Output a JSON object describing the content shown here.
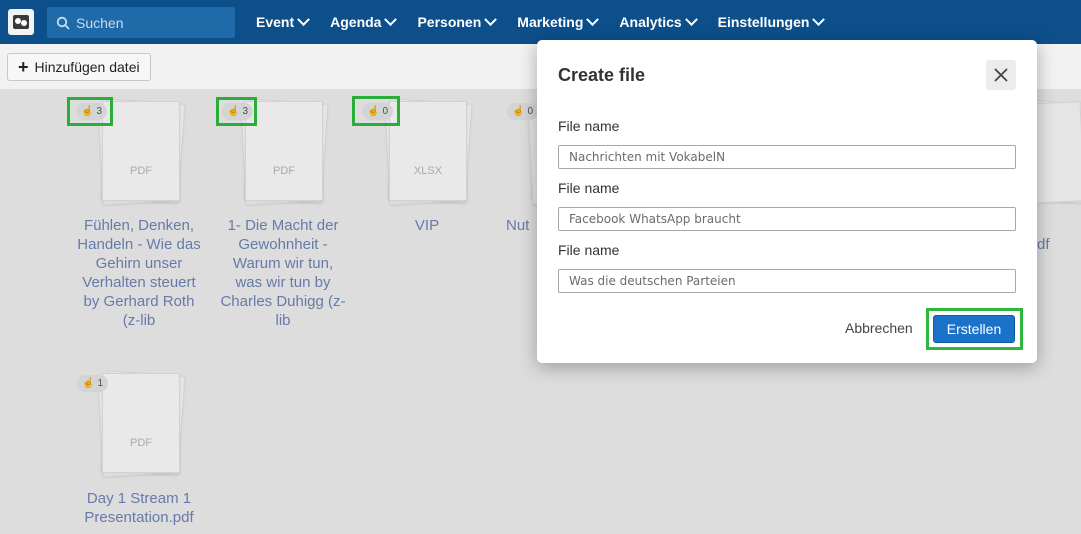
{
  "nav": {
    "search_placeholder": "Suchen",
    "menu": [
      "Event",
      "Agenda",
      "Personen",
      "Marketing",
      "Analytics",
      "Einstellungen"
    ]
  },
  "toolbar": {
    "add_label": "Hinzufügen datei"
  },
  "files": [
    {
      "type": "PDF",
      "count": "3",
      "title": "Fühlen, Denken, Handeln - Wie das Gehirn unser Verhalten steuert by Gerhard Roth (z-lib"
    },
    {
      "type": "PDF",
      "count": "3",
      "title": "1- Die Macht der Gewohnheit - Warum wir tun, was wir tun by Charles Duhigg (z-lib"
    },
    {
      "type": "XLSX",
      "count": "0",
      "title": "VIP"
    },
    {
      "type": "",
      "count": "0",
      "title": "Nut"
    },
    {
      "type": "PDF",
      "count": "1",
      "title": "Day 1 Stream 1 Presentation.pdf"
    }
  ],
  "partial_text": {
    "df": "df"
  },
  "modal": {
    "title": "Create file",
    "fields": [
      {
        "label": "File name",
        "value": "Nachrichten mit VokabelN"
      },
      {
        "label": "File name",
        "value": "Facebook WhatsApp braucht"
      },
      {
        "label": "File name",
        "value": "Was die deutschen Parteien"
      }
    ],
    "cancel_label": "Abbrechen",
    "create_label": "Erstellen"
  },
  "colors": {
    "nav": "#0d4f8b",
    "accent": "#1a73c9",
    "highlight": "#2db83d",
    "link": "#6d83b3"
  }
}
